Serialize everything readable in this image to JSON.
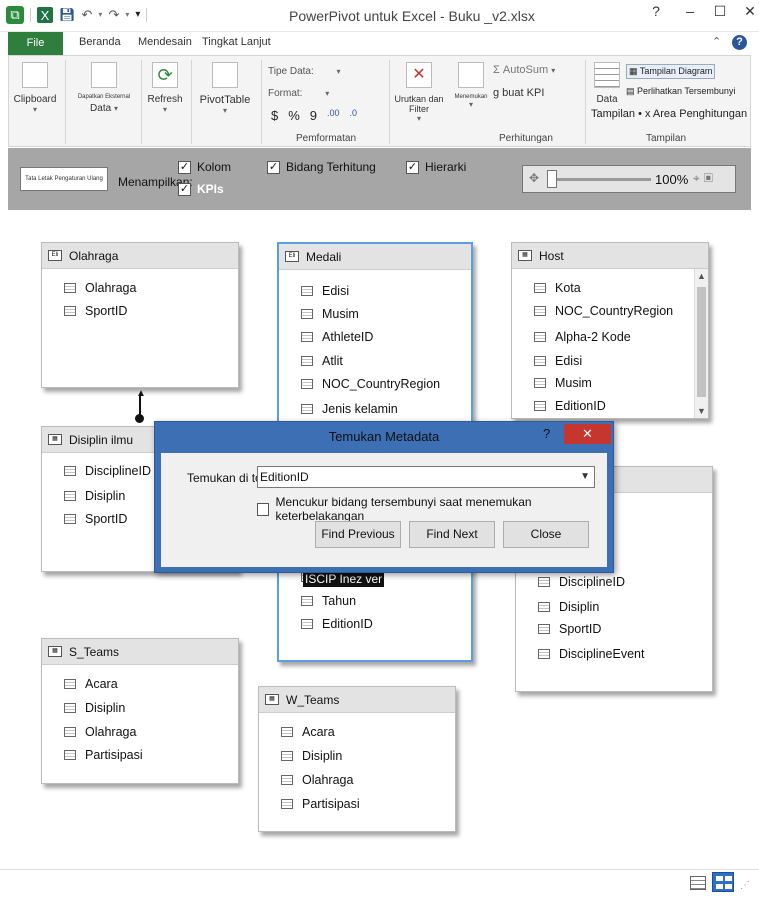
{
  "window": {
    "title": "PowerPivot untuk Excel - Buku    _v2.xlsx",
    "help": "?",
    "minimize": "–",
    "maximize": "☐",
    "close": "✕"
  },
  "qat": {
    "undo": "↶",
    "redo": "↷",
    "more": "▾"
  },
  "tabs": [
    {
      "label": "File"
    },
    {
      "label": "Beranda"
    },
    {
      "label": "Mendesain"
    },
    {
      "label": "Tingkat Lanjut"
    }
  ],
  "ribbon": {
    "clipboard": "Clipboard",
    "get_external": "Dapatkan Eksternal",
    "data": "Data",
    "refresh": "Refresh",
    "pivottable": "PivotTable",
    "data_type": "Tipe Data:",
    "format": "Format:",
    "currency": "$",
    "percent": "%",
    "comma": "9",
    "inc_dec": ".00",
    "dec_dec": ".0",
    "formatting_group": "Pemformatan",
    "sort_filter": "Urutkan dan Filter",
    "find": "Menemukan",
    "autosum": "AutoSum",
    "create_kpi": "g buat KPI",
    "calculations_group": "Perhitungan",
    "data_view_label": "Data",
    "diagram_view": "Tampilan Diagram",
    "show_hidden": "Perlihatkan Tersembunyi",
    "calc_area": "Tampilan • x Area Penghitungan",
    "view_group": "Tampilan"
  },
  "viewbar": {
    "reset_layout": "Tata Letak Pengaturan Ulang",
    "show_label": "Menampilkan:",
    "columns": "Kolom",
    "calculated_fields": "Bidang Terhitung",
    "hierarchies": "Hierarki",
    "kpis": "KPIs",
    "zoom": "100%"
  },
  "tables": {
    "olahraga": {
      "name": "Olahraga",
      "fields": [
        "Olahraga",
        "SportID"
      ]
    },
    "medali": {
      "name": "Medali",
      "fields": [
        "Edisi",
        "Musim",
        "AthleteID",
        "Atlit",
        "NOC_CountryRegion",
        "Jenis kelamin",
        "D",
        "Tahun",
        "EditionID"
      ]
    },
    "host": {
      "name": "Host",
      "fields": [
        "Kota",
        "NOC_CountryRegion",
        "Alpha-2 Kode",
        "Edisi",
        "Musim",
        "EditionID"
      ]
    },
    "disiplin": {
      "name": "Disiplin ilmu",
      "fields": [
        "DisciplineID",
        "Disiplin",
        "SportID"
      ]
    },
    "events": {
      "name": "",
      "fields": [
        "DisciplineID",
        "Disiplin",
        "SportID",
        "DisciplineEvent"
      ]
    },
    "s_teams": {
      "name": "S_Teams",
      "fields": [
        "Acara",
        "Disiplin",
        "Olahraga",
        "Partisipasi"
      ]
    },
    "w_teams": {
      "name": "W_Teams",
      "fields": [
        "Acara",
        "Disiplin",
        "Olahraga",
        "Partisipasi"
      ]
    }
  },
  "dialog": {
    "title": "Temukan Metadata",
    "help": "?",
    "close": "✕",
    "find_in_label": "Temukan di top",
    "find_value": "EditionID",
    "checkbox_label": "Mencukur bidang tersembunyi saat menemukan keterbelakangan",
    "find_previous": "Find Previous",
    "find_next": "Find Next",
    "close_btn": "Close"
  },
  "tooltip_fragment": "ISCIP Inez ver"
}
